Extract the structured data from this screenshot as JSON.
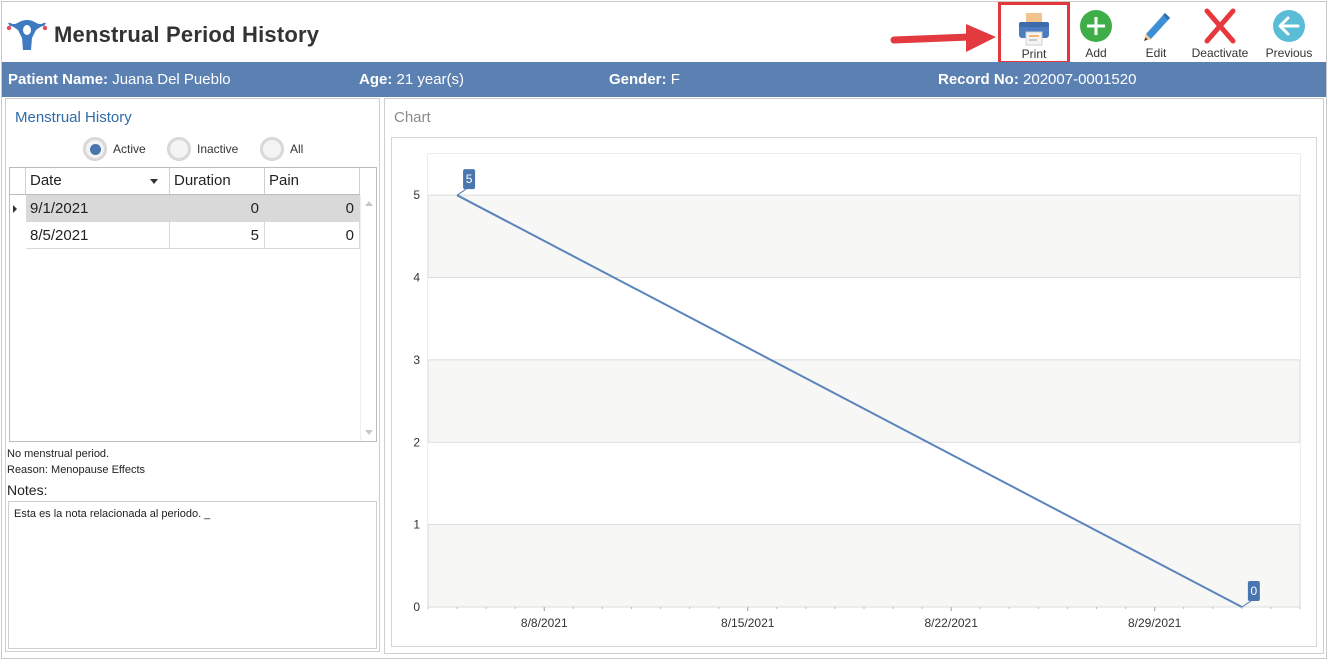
{
  "header": {
    "title": "Menstrual Period History",
    "toolbar": [
      {
        "id": "print",
        "label": "Print",
        "icon": "printer-icon"
      },
      {
        "id": "add",
        "label": "Add",
        "icon": "plus-circle-icon"
      },
      {
        "id": "edit",
        "label": "Edit",
        "icon": "pencil-icon"
      },
      {
        "id": "deactivate",
        "label": "Deactivate",
        "icon": "x-icon"
      },
      {
        "id": "previous",
        "label": "Previous",
        "icon": "arrow-left-circle-icon"
      }
    ]
  },
  "patient": {
    "name_label": "Patient Name:",
    "name": "Juana Del Pueblo",
    "age_label": "Age:",
    "age": "21 year(s)",
    "gender_label": "Gender:",
    "gender": "F",
    "record_label": "Record No:",
    "record": "202007-0001520"
  },
  "history": {
    "title": "Menstrual History",
    "filters": [
      {
        "label": "Active",
        "selected": true
      },
      {
        "label": "Inactive",
        "selected": false
      },
      {
        "label": "All",
        "selected": false
      }
    ],
    "columns": [
      "Date",
      "Duration",
      "Pain"
    ],
    "rows": [
      {
        "date": "9/1/2021",
        "duration": "0",
        "pain": "0",
        "selected": true
      },
      {
        "date": "8/5/2021",
        "duration": "5",
        "pain": "0",
        "selected": false
      }
    ],
    "status_line": "No menstrual period.",
    "reason_line": "Reason: Menopause Effects",
    "notes_label": "Notes:",
    "notes_text": "Esta es la nota relacionada al periodo. _"
  },
  "chart": {
    "title": "Chart"
  },
  "chart_data": {
    "type": "line",
    "x": [
      "2021-08-05",
      "2021-09-01"
    ],
    "y": [
      5,
      0
    ],
    "data_labels": [
      "5",
      "0"
    ],
    "xticks": [
      "8/8/2021",
      "8/15/2021",
      "8/22/2021",
      "8/29/2021"
    ],
    "yticks": [
      "0",
      "1",
      "2",
      "3",
      "4",
      "5"
    ],
    "ylim": [
      0,
      5.5
    ],
    "xlim": [
      "2021-08-04",
      "2021-09-03"
    ],
    "grid": true,
    "line_color": "#5b84bd",
    "label_color": "#4a76b0"
  },
  "colors": {
    "accent": "#5b80b2",
    "link": "#2f6aa8",
    "print_highlight": "#e2383d"
  }
}
